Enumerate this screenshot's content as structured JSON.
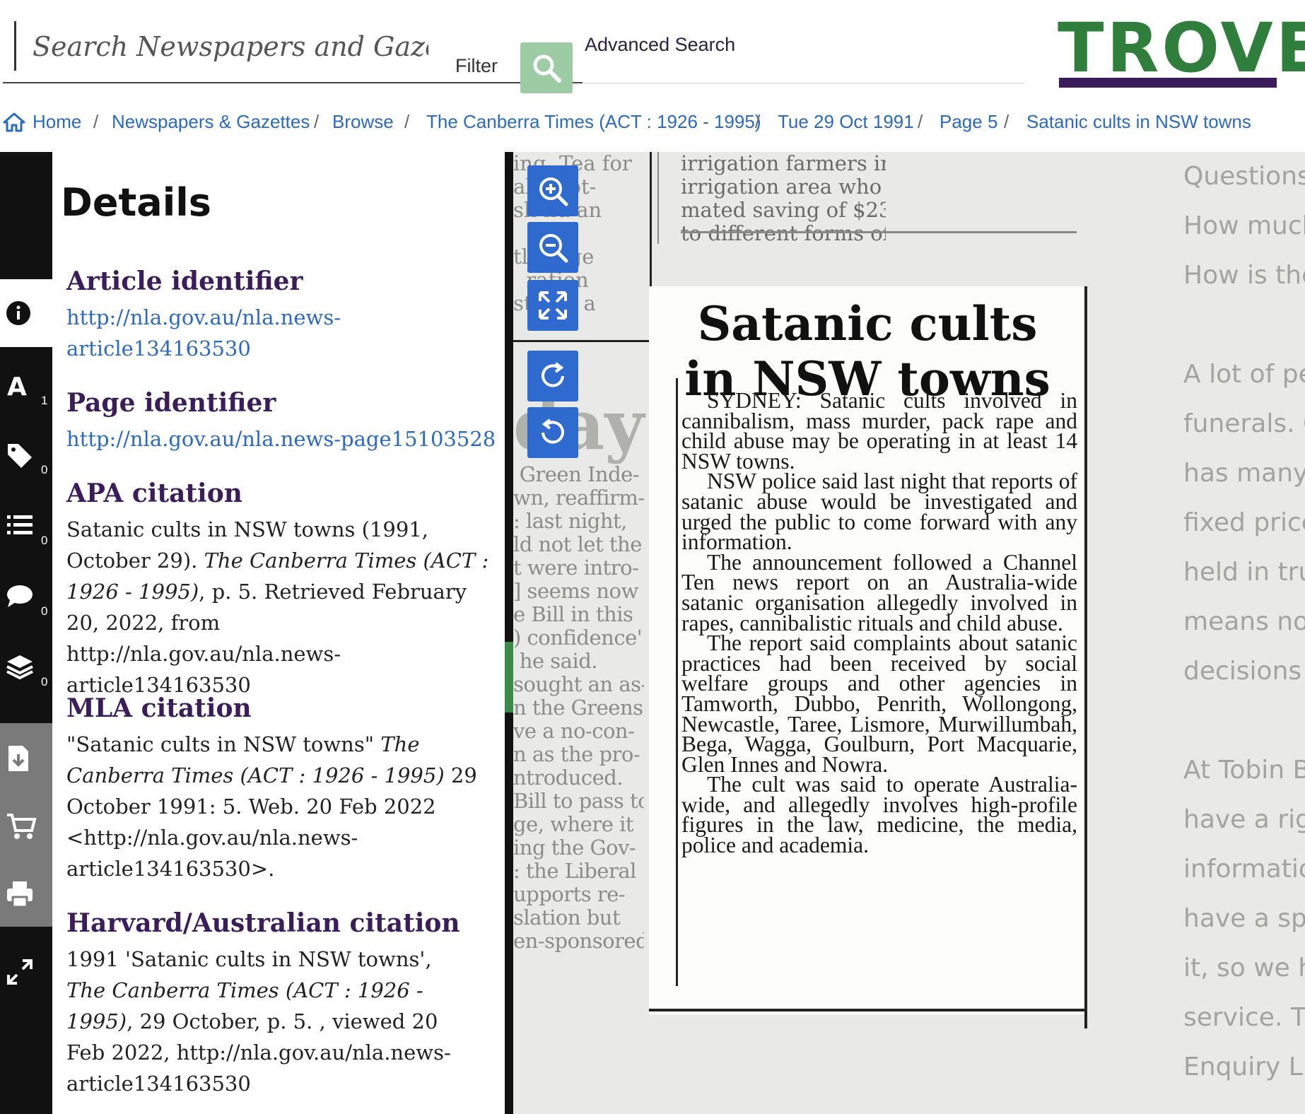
{
  "search": {
    "placeholder": "Search Newspapers and Gazettes",
    "filter_label": "Filter",
    "advanced_label": "Advanced Search"
  },
  "logo": {
    "text": "TROVE",
    "color": "#2f7e3b",
    "bar_color": "#3a1d5a"
  },
  "breadcrumb": {
    "items": [
      "Home",
      "Newspapers & Gazettes",
      "Browse",
      "The Canberra Times (ACT : 1926 - 1995)",
      "Tue 29 Oct 1991",
      "Page 5",
      "Satanic cults in NSW towns"
    ],
    "separator": "/"
  },
  "rail": {
    "items": [
      {
        "icon": "info-icon",
        "badge": ""
      },
      {
        "icon": "text-correction-icon",
        "badge": "1"
      },
      {
        "icon": "tag-icon",
        "badge": "0"
      },
      {
        "icon": "list-icon",
        "badge": "0"
      },
      {
        "icon": "comment-icon",
        "badge": "0"
      },
      {
        "icon": "layers-icon",
        "badge": "0"
      },
      {
        "icon": "download-icon",
        "badge": ""
      },
      {
        "icon": "cart-icon",
        "badge": ""
      },
      {
        "icon": "print-icon",
        "badge": ""
      },
      {
        "icon": "fullscreen-icon",
        "badge": ""
      }
    ]
  },
  "details": {
    "title": "Details",
    "article_identifier": {
      "heading": "Article identifier",
      "link": "http://nla.gov.au/nla.news-article134163530"
    },
    "page_identifier": {
      "heading": "Page identifier",
      "link": "http://nla.gov.au/nla.news-page15103528"
    },
    "apa": {
      "heading": "APA citation",
      "pre": "Satanic cults in NSW towns (1991, October 29). ",
      "italic": "The Canberra Times (ACT : 1926 - 1995)",
      "post": ", p. 5. Retrieved February 20, 2022, from http://nla.gov.au/nla.news-article134163530"
    },
    "mla": {
      "heading": "MLA citation",
      "pre": "\"Satanic cults in NSW towns\" ",
      "italic": "The Canberra Times (ACT : 1926 - 1995)",
      "post": " 29 October 1991: 5. Web. 20 Feb 2022 <http://nla.gov.au/nla.news-article134163530>."
    },
    "harvard": {
      "heading": "Harvard/Australian citation",
      "pre": "1991 'Satanic cults in NSW towns', ",
      "italic": "The Canberra Times (ACT : 1926 - 1995)",
      "post": ", 29 October, p. 5. , viewed 20 Feb 2022, http://nla.gov.au/nla.news-article134163530"
    }
  },
  "article": {
    "headline_1": "Satanic cults",
    "headline_2": "in NSW towns",
    "paragraphs": [
      "SYDNEY: Satanic cults involved in cannibalism, mass murder, pack rape and child abuse may be operating in at least 14 NSW towns.",
      "NSW police said last night that reports of satanic abuse would be investigated and urged the public to come forward with any information.",
      "The announcement followed a Channel Ten news report on an Australia-wide satanic organisation allegedly involved in rapes, cannibalistic rituals and child abuse.",
      "The report said complaints about satanic practices had been received by social welfare groups and other agencies in Tamworth, Dubbo, Penrith, Wollongong, Newcastle, Taree, Lismore, Murwillumbah, Bega, Wagga, Goulburn, Port Macquarie, Glen Innes and Nowra.",
      "The cult was said to operate Australia-wide, and allegedly involves high-profile figures in the law, medicine, the media, police and academia."
    ]
  },
  "surrounding_text": {
    "mid_top": "irrigation farmers in the Murrumbidgee\nirrigation area who have made an esti-\nmated saving of $23 million by switching\nto different forms of fertiliser.",
    "left_top": "ing, Tea for\nal a cot-\nsh nd an\n\ntl eorge\n  ration\nst and a",
    "big_fragment": "day",
    "left": " Green Inde-\nwn, reaffirm-\n: last night,\nld not let the\nt were intro-\n] seems now\ne Bill in this\n) confidence'\n he said.\nsought an as-\nn the Greens\nve a no-con-\nn as the pro-\nntroduced.\nBill to pass to\nge, where it\ning the Gov-\n: the Liberal\nupports re-\nslation but\nen-sponsored",
    "right": "Questions\nHow much\nHow is the\n\nA lot of pe\nfunerals. C\nhas many v\nfixed price\nheld in tru\nmeans no p\ndecisions l\n\nAt Tobin B\nhave a righ\ninformatio\nhave a spe\nit, so we h\nservice. Th\nEnquiry Li"
  },
  "viewer_tools": [
    "zoom-in-icon",
    "zoom-out-icon",
    "fit-screen-icon",
    "rotate-right-icon",
    "rotate-left-icon"
  ],
  "colors": {
    "accent_blue": "#2f6bcf",
    "search_green": "#9ccba4",
    "heading_purple": "#3a1d5a",
    "link_blue": "#2a6ac3"
  }
}
